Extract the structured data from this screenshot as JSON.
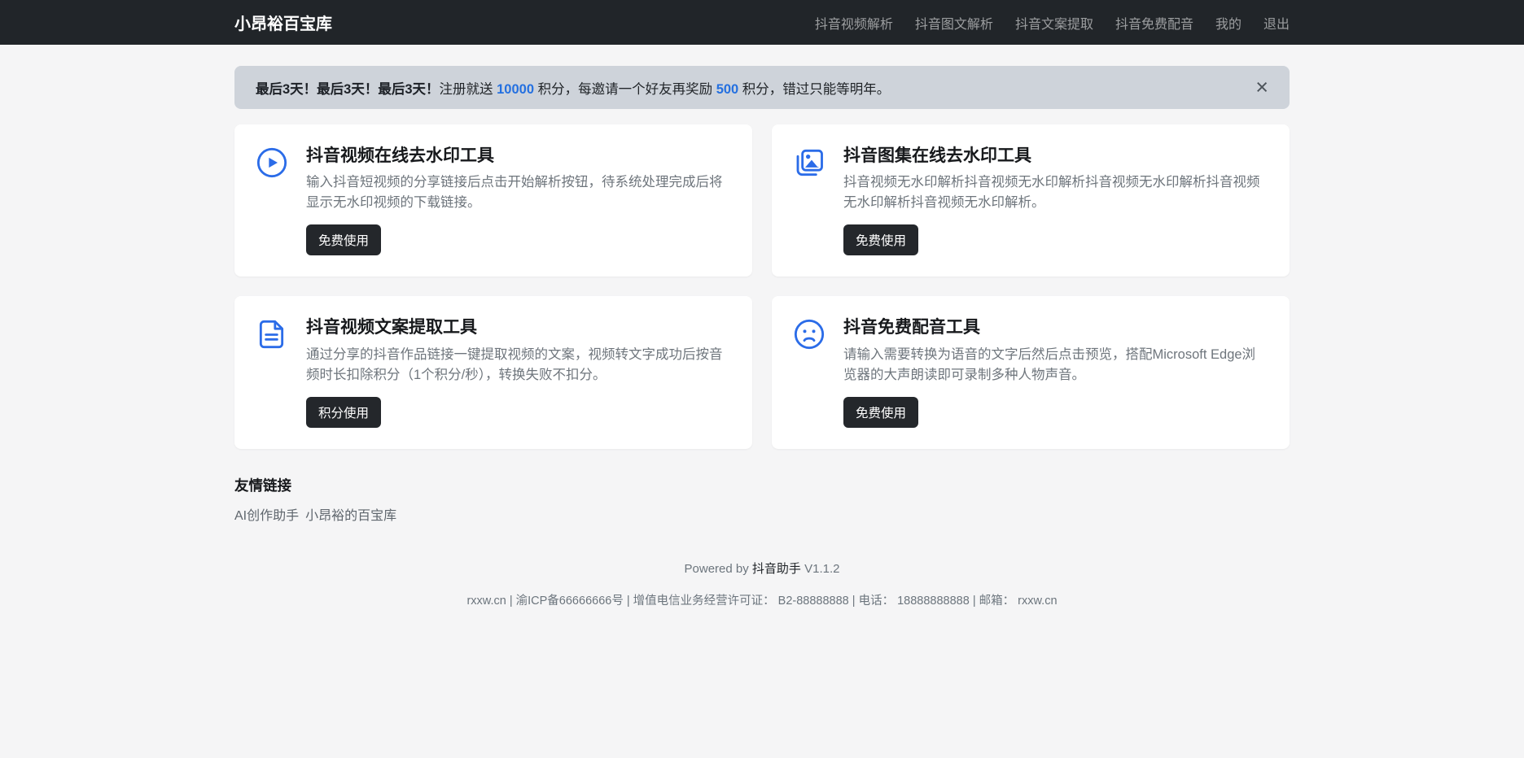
{
  "navbar": {
    "brand": "小昂裕百宝库",
    "items": [
      {
        "label": "抖音视频解析"
      },
      {
        "label": "抖音图文解析"
      },
      {
        "label": "抖音文案提取"
      },
      {
        "label": "抖音免费配音"
      },
      {
        "label": "我的"
      },
      {
        "label": "退出"
      }
    ]
  },
  "banner": {
    "segments": [
      "最后3天！最后3天！最后3天！",
      "注册就送 ",
      "10000",
      " 积分，每邀请一个好友再奖励 ",
      "500",
      " 积分，错过只能等明年。"
    ],
    "close_icon": "×"
  },
  "cards": [
    {
      "icon": "play-circle-icon",
      "title": "抖音视频在线去水印工具",
      "description": "输入抖音短视频的分享链接后点击开始解析按钮，待系统处理完成后将显示无水印视频的下载链接。",
      "button_label": "免费使用"
    },
    {
      "icon": "images-icon",
      "title": "抖音图集在线去水印工具",
      "description": "抖音视频无水印解析抖音视频无水印解析抖音视频无水印解析抖音视频无水印解析抖音视频无水印解析。",
      "button_label": "免费使用"
    },
    {
      "icon": "file-text-icon",
      "title": "抖音视频文案提取工具",
      "description": "通过分享的抖音作品链接一键提取视频的文案，视频转文字成功后按音频时长扣除积分（1个积分/秒），转换失败不扣分。",
      "button_label": "积分使用"
    },
    {
      "icon": "frown-face-icon",
      "title": "抖音免费配音工具",
      "description": "请输入需要转换为语音的文字后然后点击预览，搭配Microsoft Edge浏览器的大声朗读即可录制多种人物声音。",
      "button_label": "免费使用"
    }
  ],
  "friend_links": {
    "title": "友情链接",
    "links": [
      {
        "label": "AI创作助手"
      },
      {
        "label": "小昂裕的百宝库"
      }
    ]
  },
  "powered": {
    "prefix": "Powered by",
    "app_name": "抖音助手",
    "version": "V1.1.2"
  },
  "footer": {
    "text": "rxxw.cn | 渝ICP备66666666号 | 增值电信业务经营许可证： B2-88888888 | 电话： 18888888888 | 邮箱： rxxw.cn"
  },
  "colors": {
    "navbar_bg": "#212529",
    "banner_bg": "#ced3da",
    "accent_blue": "#2b6ce8",
    "number_blue": "#2470e0",
    "button_dark": "#24272b",
    "page_bg": "#f5f5f6"
  }
}
